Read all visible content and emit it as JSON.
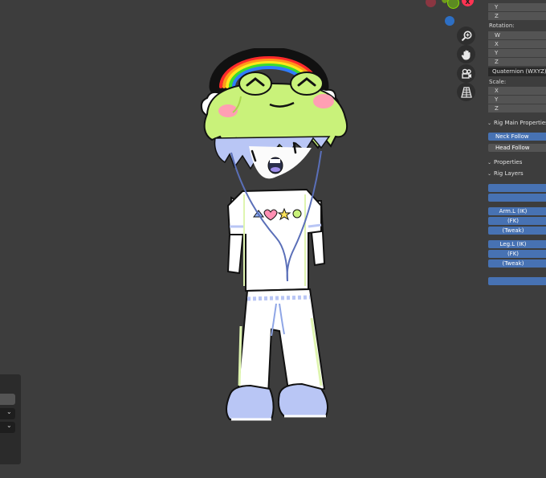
{
  "gizmo": {
    "axis_x_label": "X",
    "colors": {
      "x": "#ff3352",
      "y": "#8bdc00",
      "z": "#2890ff"
    }
  },
  "nav_tools": [
    {
      "name": "zoom",
      "icon": "zoom-icon"
    },
    {
      "name": "pan",
      "icon": "hand-icon"
    },
    {
      "name": "camera",
      "icon": "camera-icon"
    },
    {
      "name": "perspective",
      "icon": "grid-icon"
    }
  ],
  "transform": {
    "location_axes": [
      "Y",
      "Z"
    ],
    "rotation_label": "Rotation:",
    "rotation_axes": [
      "W",
      "X",
      "Y",
      "Z"
    ],
    "rotation_mode": "Quaternion (WXYZ)",
    "scale_label": "Scale:",
    "scale_axes": [
      "X",
      "Y",
      "Z"
    ]
  },
  "rig_main": {
    "header": "Rig Main Properties",
    "neck_follow": "Neck Follow",
    "head_follow": "Head Follow"
  },
  "properties_header": "Properties",
  "rig_layers": {
    "header": "Rig Layers",
    "arm_ik": "Arm.L (IK)",
    "arm_fk": "(FK)",
    "arm_tweak": "(Tweak)",
    "leg_ik": "Leg.L (IK)",
    "leg_fk": "(FK)",
    "leg_tweak": "(Tweak)"
  },
  "colors": {
    "viewport_bg": "#3d3d3d",
    "field_bg": "#545454",
    "accent_blue": "#4772b3",
    "dark_field": "#282828"
  }
}
